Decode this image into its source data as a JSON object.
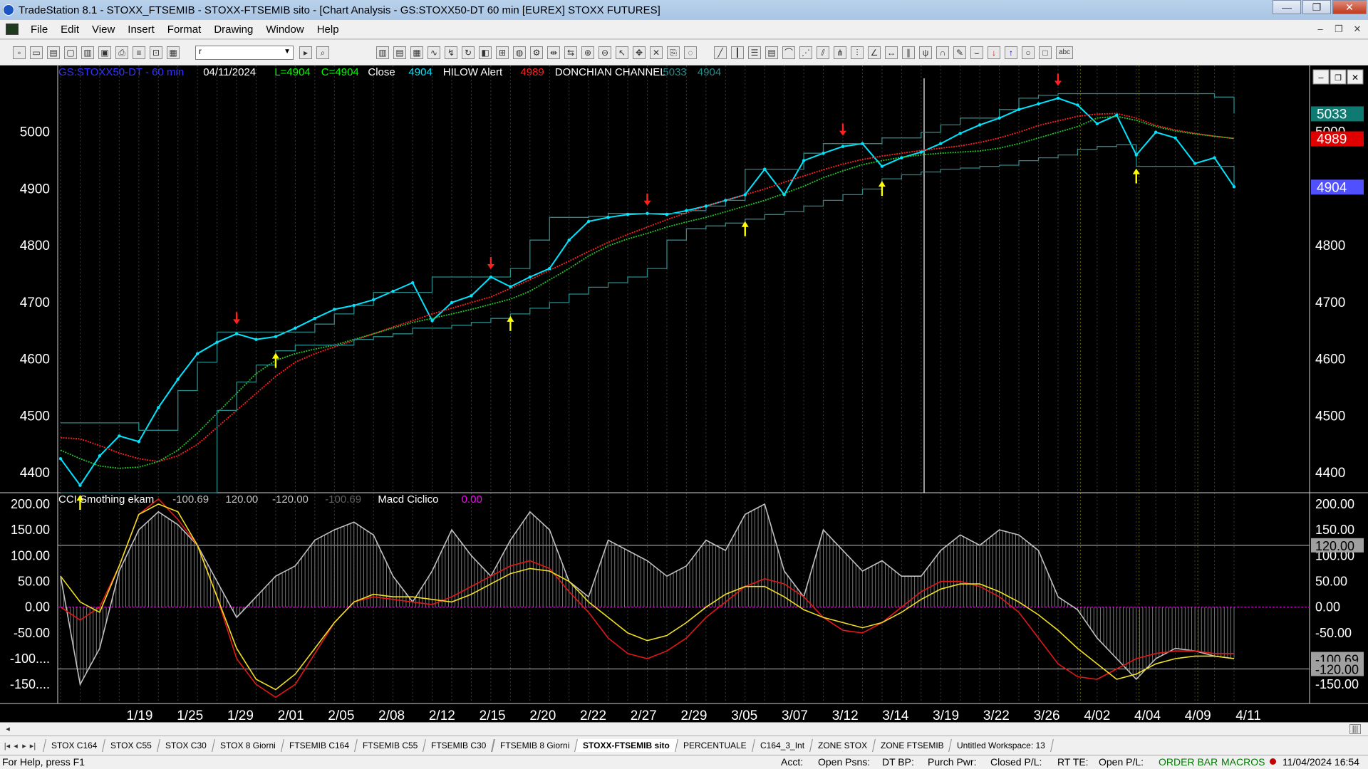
{
  "window": {
    "title": "TradeStation 8.1 - STOXX_FTSEMIB - STOXX-FTSEMIB sito - [Chart Analysis - GS:STOXX50-DT  60 min  [EUREX] STOXX FUTURES]"
  },
  "menu": [
    "File",
    "Edit",
    "View",
    "Insert",
    "Format",
    "Drawing",
    "Window",
    "Help"
  ],
  "toolbar": {
    "symbol_box": "r"
  },
  "price_pane": {
    "header": [
      {
        "text": "GS:STOXX50-DT - 60 min",
        "color": "#3333ff"
      },
      {
        "text": "04/11/2024",
        "color": "#ffffff"
      },
      {
        "text": "L=4904",
        "color": "#00ff00"
      },
      {
        "text": "C=4904",
        "color": "#00ff00"
      },
      {
        "text": "Close",
        "color": "#ffffff"
      },
      {
        "text": "4904",
        "color": "#00e5ff"
      },
      {
        "text": "HILOW Alert",
        "color": "#ffffff"
      },
      {
        "text": "4989",
        "color": "#ff2020"
      },
      {
        "text": "DONCHIAN CHANNEL",
        "color": "#ffffff"
      },
      {
        "text": "5033",
        "color": "#2a8a8a"
      },
      {
        "text": "4904",
        "color": "#2a8a8a"
      }
    ],
    "y_ticks": [
      "5000",
      "4900",
      "4800",
      "4700",
      "4600",
      "4500",
      "4400"
    ],
    "tags": [
      {
        "label": "5033",
        "bg": "#0e7a72",
        "fg": "#ffffff"
      },
      {
        "label": "4989",
        "bg": "#e00000",
        "fg": "#ffffff"
      },
      {
        "label": "4904",
        "bg": "#5050ff",
        "fg": "#ffffff"
      }
    ]
  },
  "osc_pane": {
    "header": [
      {
        "text": "CCI Smothing ekam",
        "color": "#ffffff"
      },
      {
        "text": "-100.69",
        "color": "#c0c0c0"
      },
      {
        "text": "120.00",
        "color": "#c0c0c0"
      },
      {
        "text": "-120.00",
        "color": "#c0c0c0"
      },
      {
        "text": "-100.69",
        "color": "#606060"
      },
      {
        "text": "Macd Ciclico",
        "color": "#ffffff"
      },
      {
        "text": "0.00",
        "color": "#ff00ff"
      }
    ],
    "y_ticks": [
      "200.00",
      "150.00",
      "100.00",
      "50.00",
      "0.00",
      "-50.00",
      "-100....",
      "-150...."
    ],
    "y_ticks_right": [
      "200.00",
      "150.00",
      "100.00",
      "50.00",
      "0.00",
      "-50.00",
      "-100.00",
      "-150.00"
    ],
    "tags": [
      {
        "label": "120.00",
        "bg": "#a0a0a0",
        "fg": "#000000"
      },
      {
        "label": "-100.69",
        "bg": "#a0a0a0",
        "fg": "#000000"
      },
      {
        "label": "-120.00",
        "bg": "#a0a0a0",
        "fg": "#000000"
      }
    ]
  },
  "x_labels": [
    "1/19",
    "1/25",
    "1/29",
    "2/01",
    "2/05",
    "2/08",
    "2/12",
    "2/15",
    "2/20",
    "2/22",
    "2/27",
    "2/29",
    "3/05",
    "3/07",
    "3/12",
    "3/14",
    "3/19",
    "3/22",
    "3/26",
    "4/02",
    "4/04",
    "4/09",
    "4/11"
  ],
  "chart_data": [
    {
      "type": "line",
      "title": "GS:STOXX50-DT - 60 min",
      "ylim": [
        4365,
        5095
      ],
      "x": [
        "1/16",
        "1/17",
        "1/18",
        "1/19",
        "1/22",
        "1/23",
        "1/24",
        "1/25",
        "1/26",
        "1/29",
        "1/30",
        "1/31",
        "2/01",
        "2/02",
        "2/05",
        "2/06",
        "2/07",
        "2/08",
        "2/09",
        "2/12",
        "2/13",
        "2/14",
        "2/15",
        "2/16",
        "2/19",
        "2/20",
        "2/21",
        "2/22",
        "2/23",
        "2/26",
        "2/27",
        "2/28",
        "2/29",
        "3/01",
        "3/04",
        "3/05",
        "3/06",
        "3/07",
        "3/08",
        "3/11",
        "3/12",
        "3/13",
        "3/14",
        "3/15",
        "3/18",
        "3/19",
        "3/20",
        "3/21",
        "3/22",
        "3/25",
        "3/26",
        "3/27",
        "3/28",
        "4/02",
        "4/03",
        "4/04",
        "4/05",
        "4/08",
        "4/09",
        "4/10",
        "4/11"
      ],
      "series": [
        {
          "name": "Close",
          "color": "#00e5ff",
          "values": [
            4425,
            4378,
            4430,
            4465,
            4455,
            4515,
            4565,
            4610,
            4630,
            4645,
            4635,
            4640,
            4655,
            4672,
            4688,
            4695,
            4705,
            4720,
            4735,
            4668,
            4700,
            4712,
            4745,
            4728,
            4745,
            4760,
            4810,
            4843,
            4850,
            4855,
            4857,
            4855,
            4862,
            4870,
            4880,
            4890,
            4935,
            4890,
            4950,
            4963,
            4975,
            4980,
            4940,
            4955,
            4965,
            4980,
            4998,
            5013,
            5025,
            5040,
            5050,
            5060,
            5048,
            5015,
            5030,
            4960,
            5000,
            4990,
            4945,
            4955,
            4904
          ]
        },
        {
          "name": "HILOW Alert",
          "color": "#ff2020",
          "values": [
            4462,
            4460,
            4448,
            4435,
            4425,
            4420,
            4430,
            4450,
            4480,
            4510,
            4540,
            4570,
            4595,
            4610,
            4622,
            4633,
            4645,
            4657,
            4668,
            4680,
            4690,
            4700,
            4710,
            4725,
            4740,
            4757,
            4773,
            4790,
            4806,
            4820,
            4833,
            4846,
            4858,
            4870,
            4880,
            4890,
            4900,
            4912,
            4923,
            4934,
            4944,
            4952,
            4958,
            4963,
            4968,
            4972,
            4976,
            4982,
            4990,
            5000,
            5012,
            5020,
            5028,
            5032,
            5033,
            5025,
            5012,
            5004,
            4998,
            4993,
            4989
          ]
        },
        {
          "name": "smoothing",
          "color": "#22c22a",
          "values": [
            4440,
            4425,
            4412,
            4408,
            4410,
            4420,
            4440,
            4470,
            4505,
            4540,
            4575,
            4598,
            4610,
            4618,
            4625,
            4635,
            4645,
            4655,
            4665,
            4672,
            4680,
            4688,
            4697,
            4706,
            4720,
            4740,
            4760,
            4782,
            4800,
            4812,
            4822,
            4833,
            4842,
            4850,
            4860,
            4870,
            4880,
            4892,
            4905,
            4920,
            4932,
            4943,
            4950,
            4956,
            4960,
            4963,
            4965,
            4967,
            4972,
            4980,
            4990,
            5000,
            5010,
            5025,
            5028,
            5021,
            5010,
            5002,
            4997,
            4993,
            4989
          ]
        },
        {
          "name": "DONCHIAN CHANNEL",
          "color": "#2a8a8a",
          "values": [
            4488,
            4488,
            4488,
            4488,
            4475,
            4475,
            4545,
            4595,
            4648,
            4648,
            4648,
            4648,
            4648,
            4662,
            4680,
            4695,
            4718,
            4718,
            4718,
            4745,
            4745,
            4745,
            4745,
            4760,
            4810,
            4850,
            4850,
            4852,
            4857,
            4857,
            4857,
            4857,
            4862,
            4870,
            4880,
            4935,
            4935,
            4935,
            4963,
            4980,
            4980,
            4980,
            4990,
            4990,
            5000,
            5013,
            5025,
            5025,
            5040,
            5060,
            5065,
            5068,
            5068,
            5068,
            5068,
            5068,
            5068,
            5068,
            5068,
            5062,
            5033
          ]
        },
        {
          "name": "DONCHIAN CHANNEL",
          "color": "#2a8a8a",
          "values": [
            4365,
            4365,
            4365,
            4365,
            4365,
            4365,
            4365,
            4365,
            4510,
            4560,
            4590,
            4615,
            4625,
            4625,
            4625,
            4635,
            4640,
            4645,
            4655,
            4655,
            4660,
            4665,
            4672,
            4680,
            4690,
            4700,
            4715,
            4727,
            4735,
            4745,
            4760,
            4810,
            4830,
            4835,
            4840,
            4847,
            4855,
            4860,
            4870,
            4880,
            4890,
            4900,
            4918,
            4925,
            4930,
            4935,
            4937,
            4940,
            4942,
            4950,
            4955,
            4960,
            4970,
            4975,
            4978,
            4940,
            4940,
            4940,
            4940,
            4940,
            4904
          ]
        }
      ],
      "annotations": [
        {
          "type": "down-arrow",
          "x": "1/29",
          "color": "#ff2020"
        },
        {
          "type": "down-arrow",
          "x": "2/15",
          "color": "#ff2020"
        },
        {
          "type": "down-arrow",
          "x": "2/27",
          "color": "#ff2020"
        },
        {
          "type": "down-arrow",
          "x": "3/12",
          "color": "#ff2020"
        },
        {
          "type": "down-arrow",
          "x": "3/27",
          "color": "#ff2020"
        },
        {
          "type": "up-arrow",
          "x": "1/17",
          "color": "#ffff00"
        },
        {
          "type": "up-arrow",
          "x": "1/31",
          "color": "#ffff00"
        },
        {
          "type": "up-arrow",
          "x": "2/16",
          "color": "#ffff00"
        },
        {
          "type": "up-arrow",
          "x": "3/05",
          "color": "#ffff00"
        },
        {
          "type": "up-arrow",
          "x": "3/14",
          "color": "#ffff00"
        },
        {
          "type": "up-arrow",
          "x": "4/04",
          "color": "#ffff00"
        }
      ]
    },
    {
      "type": "line",
      "title": "CCI Smothing ekam / Macd Ciclico",
      "ylim": [
        -187,
        222
      ],
      "hlines": [
        {
          "y": 120,
          "color": "#c0c0c0"
        },
        {
          "y": -120,
          "color": "#c0c0c0"
        },
        {
          "y": 0,
          "color": "#b000b0"
        }
      ],
      "series": [
        {
          "name": "CCI Smothing ekam",
          "color": "#c0c0c0",
          "values": [
            60,
            -150,
            -80,
            70,
            150,
            185,
            160,
            120,
            50,
            -20,
            20,
            60,
            80,
            130,
            150,
            165,
            140,
            60,
            10,
            70,
            150,
            100,
            60,
            130,
            185,
            150,
            50,
            20,
            130,
            110,
            90,
            60,
            80,
            130,
            110,
            180,
            200,
            70,
            20,
            150,
            110,
            70,
            90,
            60,
            60,
            110,
            140,
            120,
            150,
            140,
            110,
            20,
            -5,
            -60,
            -100,
            -140,
            -100,
            -80,
            -85,
            -95,
            -100
          ]
        },
        {
          "name": "series-red",
          "color": "#e01818",
          "values": [
            0,
            -25,
            0,
            80,
            180,
            210,
            170,
            120,
            20,
            -100,
            -150,
            -175,
            -150,
            -90,
            -30,
            10,
            20,
            15,
            10,
            5,
            20,
            40,
            60,
            80,
            90,
            75,
            30,
            -10,
            -60,
            -90,
            -100,
            -85,
            -60,
            -20,
            10,
            40,
            55,
            45,
            20,
            -20,
            -45,
            -50,
            -30,
            0,
            30,
            50,
            50,
            40,
            20,
            -10,
            -60,
            -110,
            -135,
            -140,
            -120,
            -100,
            -90,
            -85,
            -85,
            -90,
            -90
          ]
        },
        {
          "name": "series-yellow",
          "color": "#f0e020",
          "values": [
            60,
            10,
            -10,
            80,
            180,
            200,
            185,
            120,
            20,
            -80,
            -140,
            -160,
            -130,
            -80,
            -30,
            10,
            25,
            20,
            20,
            15,
            10,
            25,
            45,
            65,
            75,
            70,
            50,
            10,
            -20,
            -50,
            -65,
            -55,
            -30,
            0,
            25,
            40,
            40,
            20,
            -5,
            -20,
            -30,
            -40,
            -30,
            -10,
            15,
            35,
            45,
            45,
            30,
            10,
            -15,
            -45,
            -80,
            -110,
            -140,
            -130,
            -110,
            -100,
            -95,
            -95,
            -100
          ]
        }
      ]
    }
  ]
}
